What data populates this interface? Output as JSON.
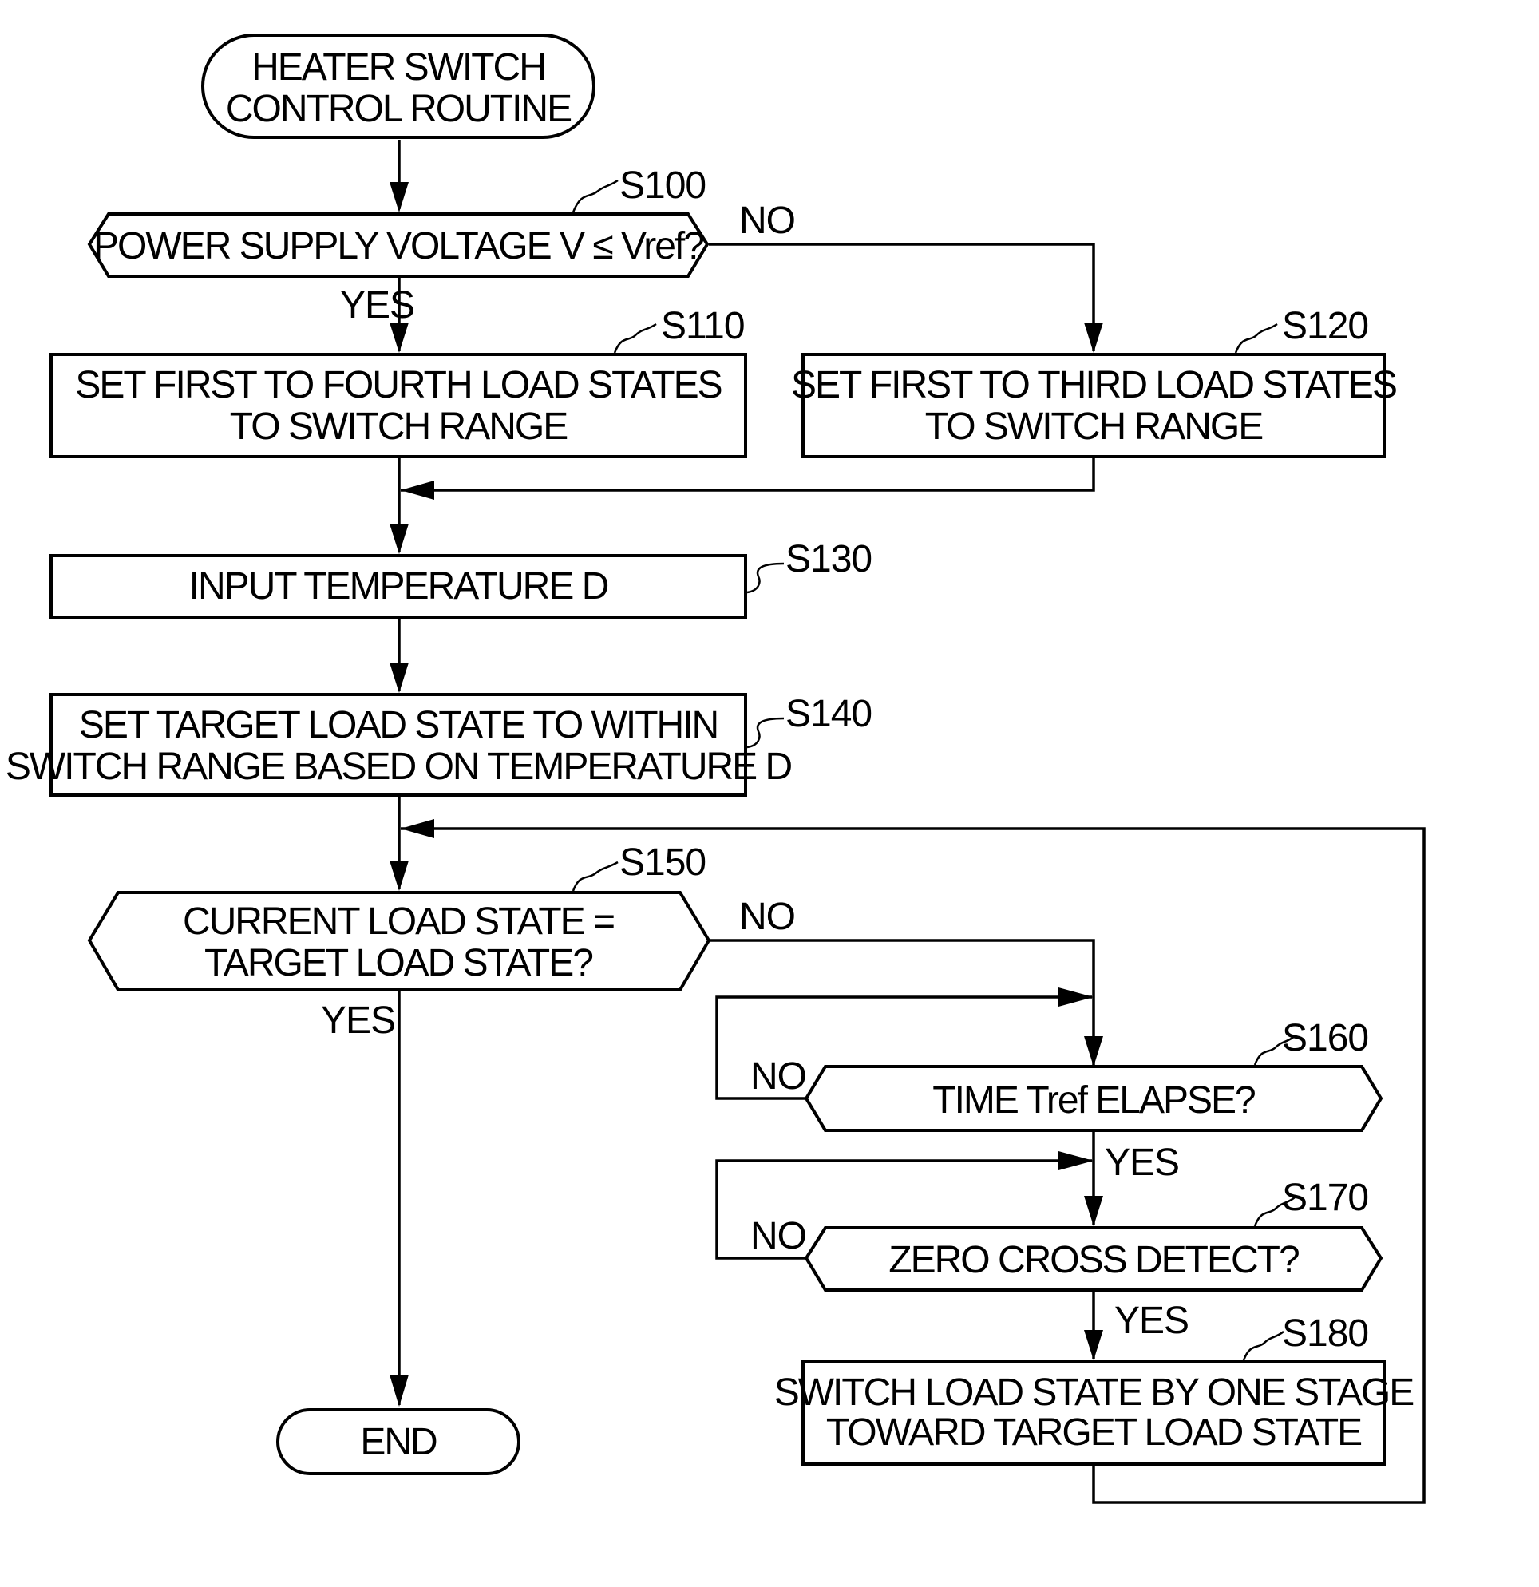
{
  "diagram": {
    "type": "flowchart",
    "start": {
      "lines": [
        "HEATER SWITCH",
        "CONTROL ROUTINE"
      ]
    },
    "end": {
      "label": "END"
    },
    "steps": {
      "s100": {
        "id": "S100",
        "kind": "decision",
        "lines": [
          "POWER SUPPLY VOLTAGE V ≤ Vref?"
        ],
        "yes": "YES",
        "no": "NO"
      },
      "s110": {
        "id": "S110",
        "kind": "process",
        "lines": [
          "SET FIRST TO FOURTH LOAD STATES",
          "TO SWITCH RANGE"
        ]
      },
      "s120": {
        "id": "S120",
        "kind": "process",
        "lines": [
          "SET FIRST TO THIRD LOAD STATES",
          "TO SWITCH RANGE"
        ]
      },
      "s130": {
        "id": "S130",
        "kind": "process",
        "lines": [
          "INPUT TEMPERATURE D"
        ]
      },
      "s140": {
        "id": "S140",
        "kind": "process",
        "lines": [
          "SET TARGET LOAD STATE TO WITHIN",
          "SWITCH RANGE BASED ON TEMPERATURE D"
        ]
      },
      "s150": {
        "id": "S150",
        "kind": "decision",
        "lines": [
          "CURRENT LOAD STATE =",
          "TARGET LOAD STATE?"
        ],
        "yes": "YES",
        "no": "NO"
      },
      "s160": {
        "id": "S160",
        "kind": "decision",
        "lines": [
          "TIME Tref ELAPSE?"
        ],
        "yes": "YES",
        "no": "NO"
      },
      "s170": {
        "id": "S170",
        "kind": "decision",
        "lines": [
          "ZERO CROSS DETECT?"
        ],
        "yes": "YES",
        "no": "NO"
      },
      "s180": {
        "id": "S180",
        "kind": "process",
        "lines": [
          "SWITCH LOAD STATE BY ONE STAGE",
          "TOWARD TARGET LOAD STATE"
        ]
      }
    },
    "edges": [
      {
        "from": "start",
        "to": "S100"
      },
      {
        "from": "S100",
        "to": "S110",
        "label": "YES"
      },
      {
        "from": "S100",
        "to": "S120",
        "label": "NO"
      },
      {
        "from": "S110",
        "to": "S130"
      },
      {
        "from": "S120",
        "to": "S130"
      },
      {
        "from": "S130",
        "to": "S140"
      },
      {
        "from": "S140",
        "to": "S150"
      },
      {
        "from": "S150",
        "to": "end",
        "label": "YES"
      },
      {
        "from": "S150",
        "to": "S160",
        "label": "NO"
      },
      {
        "from": "S160",
        "to": "S160",
        "label": "NO"
      },
      {
        "from": "S160",
        "to": "S170",
        "label": "YES"
      },
      {
        "from": "S170",
        "to": "S170",
        "label": "NO"
      },
      {
        "from": "S170",
        "to": "S180",
        "label": "YES"
      },
      {
        "from": "S180",
        "to": "S150"
      }
    ]
  }
}
